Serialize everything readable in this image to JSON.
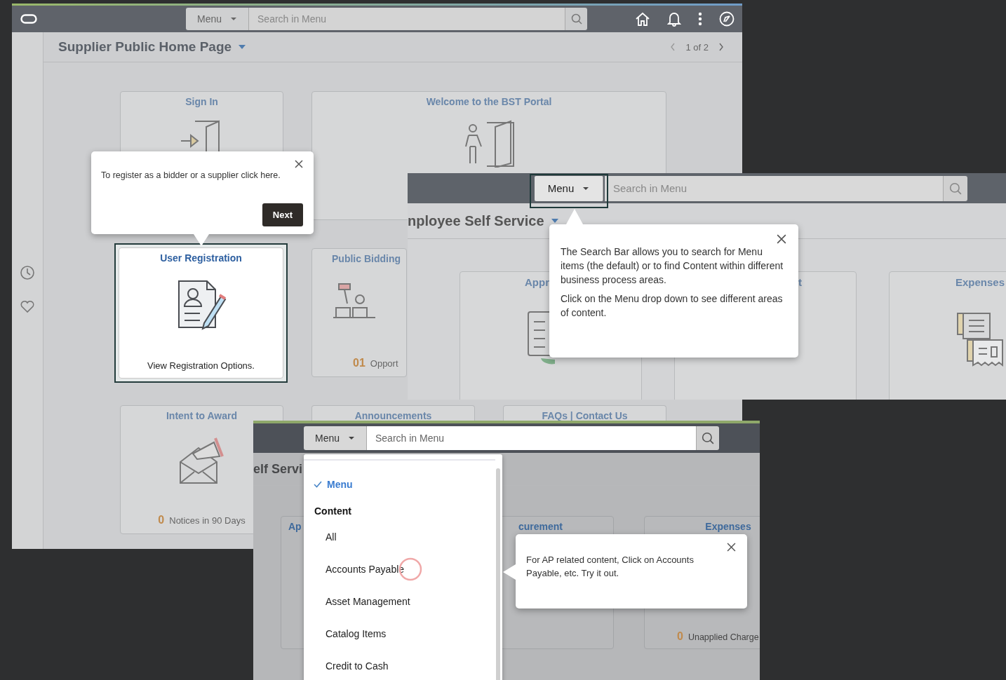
{
  "supplier_home_screen": {
    "menu_button": "Menu",
    "search_placeholder": "Search in Menu",
    "page_title": "Supplier Public Home Page",
    "pager": "1 of 2",
    "tiles": [
      {
        "title": "Sign In",
        "selected": false
      },
      {
        "title": "Welcome to the BST Portal",
        "selected": false
      },
      {
        "title": "User Registration",
        "selected": true,
        "text": "View Registration Options."
      },
      {
        "title": "Public Bidding",
        "selected": false,
        "count": "01",
        "count_label": "Opport"
      },
      {
        "title": "Intent to Award",
        "selected": false,
        "count": "0",
        "count_label": "Notices in 90 Days"
      },
      {
        "title": "Announcements",
        "selected": false
      },
      {
        "title": "FAQs | Contact Us",
        "selected": false
      }
    ],
    "tooltip": {
      "text": "To register as a bidder or a supplier click here.",
      "button": "Next"
    }
  },
  "search_bar_screen": {
    "menu_button": "Menu",
    "menu_highlighted": true,
    "search_placeholder": "Search in Menu",
    "page_title": "nployee Self Service",
    "tiles": [
      {
        "title": "Appr"
      },
      {
        "title": "t"
      },
      {
        "title": "Expenses"
      }
    ],
    "tooltip": {
      "paragraphs": [
        "The Search Bar allows you to search for Menu items (the default) or to find Content within different business process areas.",
        "Click on the Menu drop down to see different areas of content."
      ]
    }
  },
  "menu_dropdown_screen": {
    "menu_button": "Menu",
    "search_placeholder": "Search in Menu",
    "page_title": "elf Servi",
    "menu_items": [
      {
        "kind": "option",
        "label": "Menu",
        "checked": true,
        "clicked": false
      },
      {
        "kind": "heading",
        "label": "Content"
      },
      {
        "kind": "option",
        "label": "All",
        "checked": false,
        "clicked": false
      },
      {
        "kind": "option",
        "label": "Accounts Payable",
        "checked": false,
        "clicked": true
      },
      {
        "kind": "option",
        "label": "Asset Management",
        "checked": false,
        "clicked": false
      },
      {
        "kind": "option",
        "label": "Catalog Items",
        "checked": false,
        "clicked": false
      },
      {
        "kind": "option",
        "label": "Credit to Cash",
        "checked": false,
        "clicked": false
      }
    ],
    "tiles": [
      {
        "title": "Ap"
      },
      {
        "title": "curement"
      },
      {
        "title": "Expenses",
        "count": "0",
        "count_label": "Unapplied Charge"
      }
    ],
    "tooltip": {
      "text": "For AP related content, Click on Accounts Payable, etc. Try it out."
    }
  }
}
